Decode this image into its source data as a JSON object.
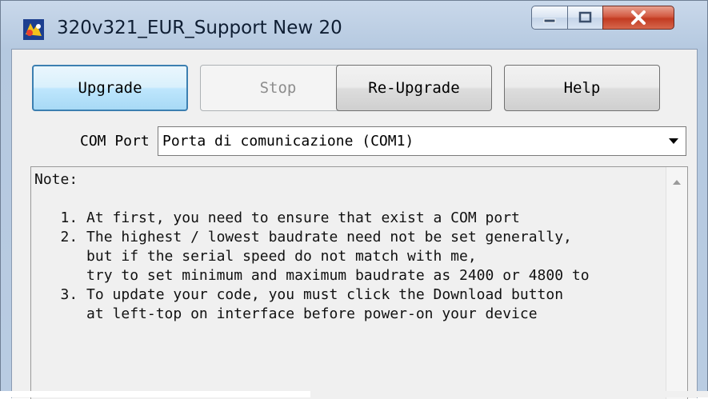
{
  "window": {
    "title": "320v321_EUR_Support New 20",
    "icon": "app-icon"
  },
  "caption_buttons": {
    "minimize_icon": "minimize-icon",
    "maximize_icon": "maximize-icon",
    "close_icon": "close-icon"
  },
  "toolbar": {
    "upgrade_label": "Upgrade",
    "stop_label": "Stop",
    "reupgrade_label": "Re-Upgrade",
    "help_label": "Help"
  },
  "com_port": {
    "label": "COM Port",
    "selected_value": "Porta di comunicazione (COM1)"
  },
  "notes": {
    "lines": [
      "Note:",
      "",
      "   1. At first, you need to ensure that exist a COM port",
      "   2. The highest / lowest baudrate need not be set generally,",
      "      but if the serial speed do not match with me,",
      "      try to set minimum and maximum baudrate as 2400 or 4800 to",
      "   3. To update your code, you must click the Download button",
      "      at left-top on interface before power-on your device"
    ]
  },
  "colors": {
    "titlebar": "#b9cce2",
    "client_bg": "#f0f0f0",
    "focus_border": "#3c7fb1",
    "close_red": "#c23b22"
  }
}
